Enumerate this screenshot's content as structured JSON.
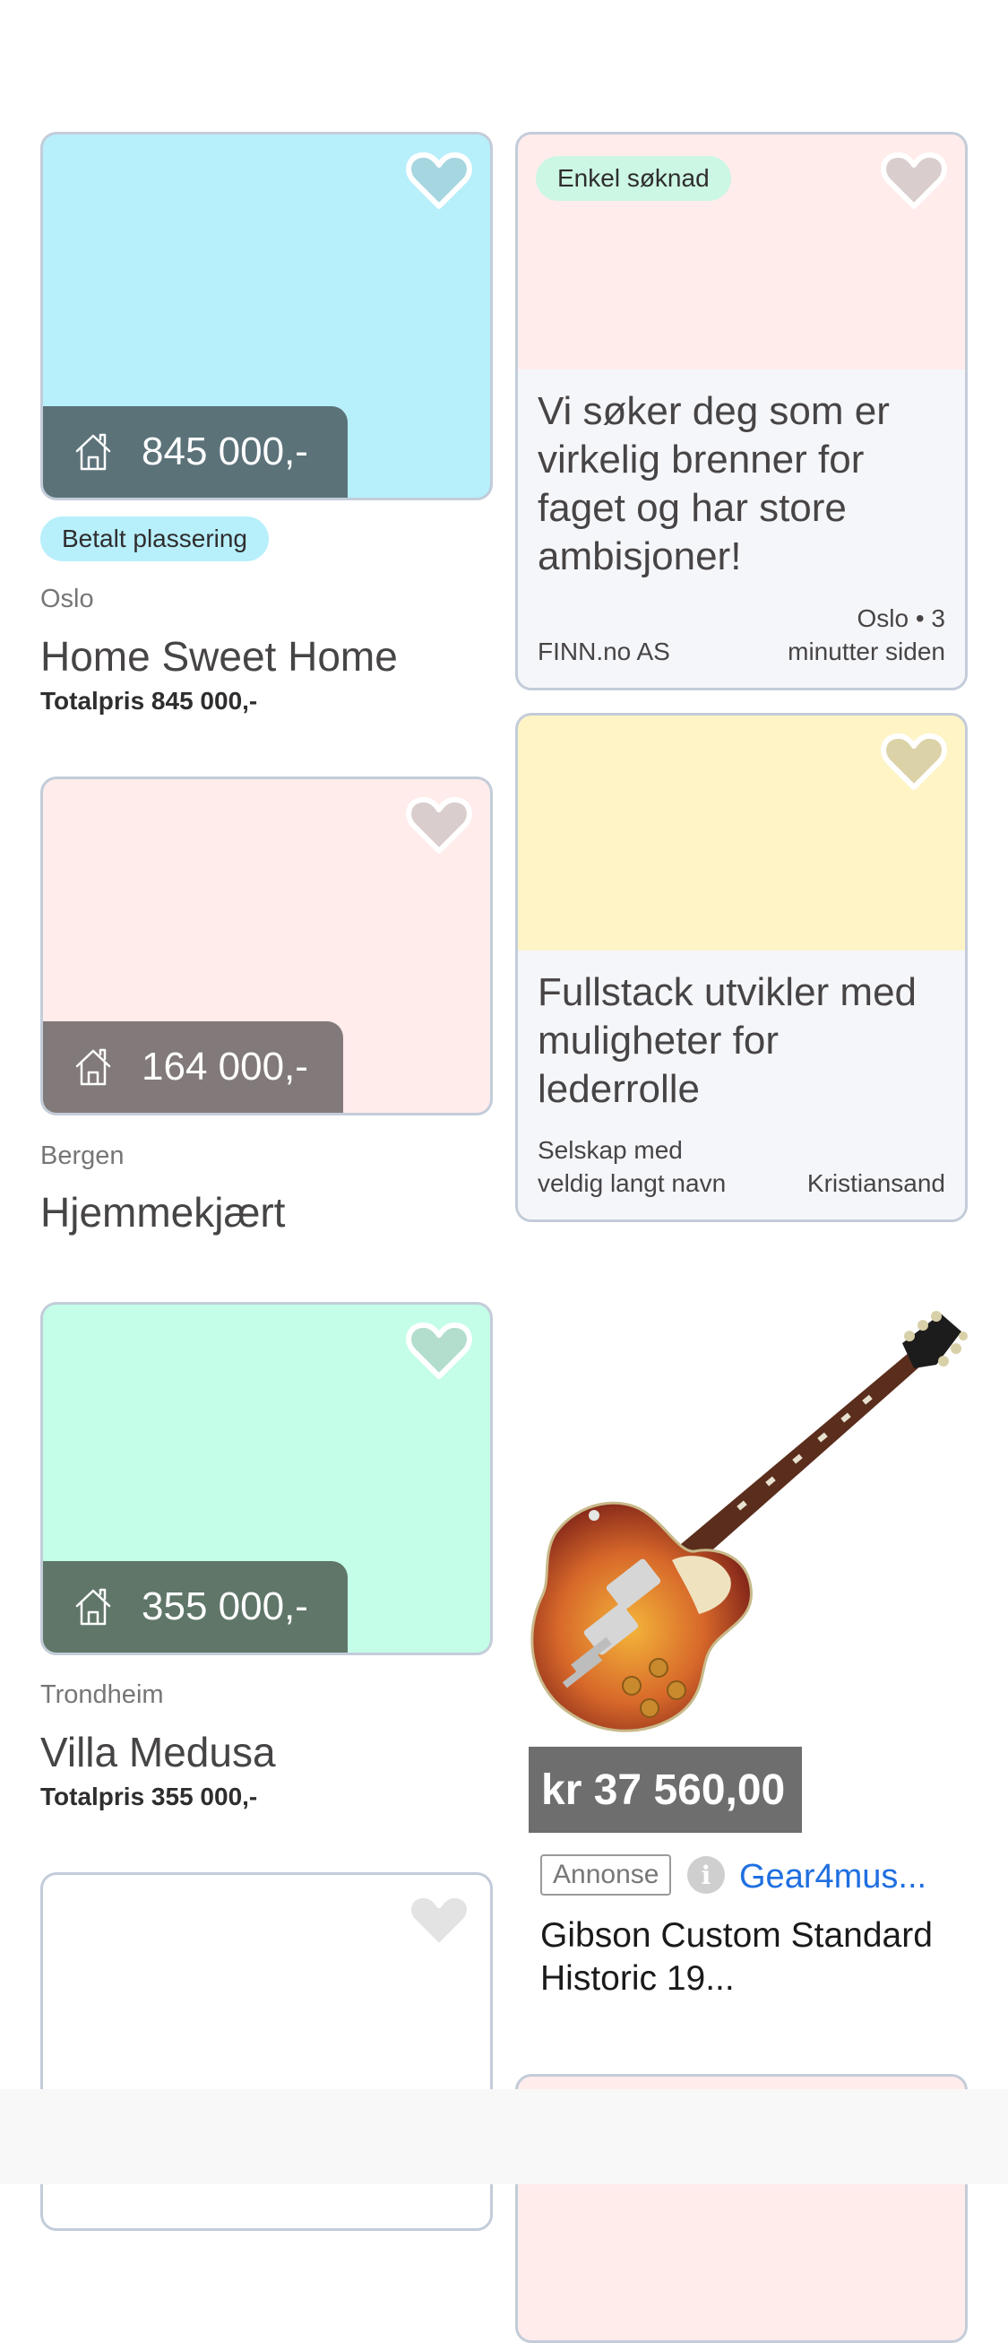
{
  "listings": [
    {
      "location": "Oslo",
      "title": "Home Sweet Home",
      "price": "845 000,-",
      "total": "Totalpris 845 000,-",
      "paid_badge": "Betalt plassering",
      "image_color": "#b7effb",
      "badge_color": "#5b7279"
    },
    {
      "location": "Bergen",
      "title": "Hjemmekjært",
      "price": "164 000,-",
      "image_color": "#ffeceb",
      "badge_color": "#827a7a"
    },
    {
      "location": "Trondheim",
      "title": "Villa Medusa",
      "price": "355 000,-",
      "total": "Totalpris 355 000,-",
      "image_color": "#c4fde8",
      "badge_color": "#5f7669"
    },
    {
      "image_color": "#ffffff"
    }
  ],
  "jobs": [
    {
      "badge": "Enkel søknad",
      "title": "Vi søker deg som er virkelig brenner for faget og har store ambisjoner!",
      "company": "FINN.no AS",
      "meta": "Oslo • 3 minutter siden",
      "image_color": "#ffeceb"
    },
    {
      "title": "Fullstack utvikler med muligheter for lederrolle",
      "company": "Selskap med veldig langt navn",
      "location": "Kristiansand",
      "image_color": "#fef4c6"
    }
  ],
  "ad": {
    "price": "kr 37 560,00",
    "label": "Annonse",
    "advertiser": "Gear4mus...",
    "title": "Gibson Custom Standard Historic 19...",
    "info_icon": "info-icon"
  }
}
